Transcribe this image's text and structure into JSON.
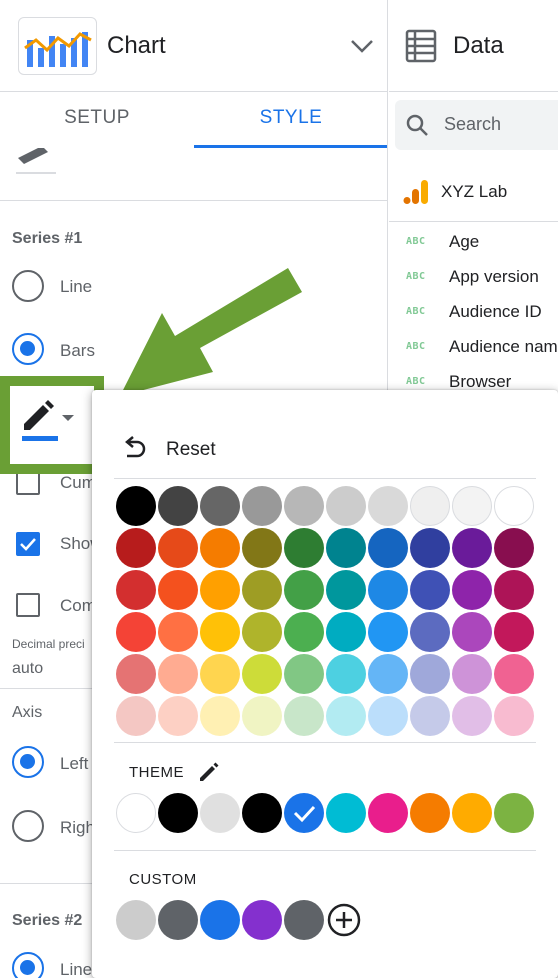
{
  "chart_panel": {
    "title": "Chart",
    "tabs": [
      {
        "label": "SETUP",
        "active": false
      },
      {
        "label": "STYLE",
        "active": true
      }
    ]
  },
  "style": {
    "series1": {
      "heading": "Series #1",
      "type_options": [
        {
          "label": "Line",
          "checked": false
        },
        {
          "label": "Bars",
          "checked": true
        }
      ],
      "checkboxes": [
        {
          "label": "Cum",
          "checked": false
        },
        {
          "label": "Show",
          "checked": true
        },
        {
          "label": "Com",
          "checked": false
        }
      ],
      "decimal_precision_label": "Decimal preci",
      "decimal_precision_value": "auto",
      "axis_heading": "Axis",
      "axis_options": [
        {
          "label": "Left",
          "checked": true
        },
        {
          "label": "Righ",
          "checked": false
        }
      ]
    },
    "series2": {
      "heading": "Series #2",
      "type_options": [
        {
          "label": "Line",
          "checked": true
        }
      ]
    },
    "series_color": "#1a73e8"
  },
  "data_panel": {
    "title": "Data",
    "search_placeholder": "Search",
    "source_name": "XYZ Lab",
    "fields": [
      {
        "type": "ABC",
        "name": "Age"
      },
      {
        "type": "ABC",
        "name": "App version"
      },
      {
        "type": "ABC",
        "name": "Audience ID"
      },
      {
        "type": "ABC",
        "name": "Audience name"
      },
      {
        "type": "ABC",
        "name": "Browser"
      }
    ]
  },
  "color_picker": {
    "reset_label": "Reset",
    "palette": [
      [
        "#000000",
        "#434343",
        "#666666",
        "#999999",
        "#b7b7b7",
        "#cccccc",
        "#d9d9d9",
        "#efefef",
        "#f3f3f3",
        "#ffffff"
      ],
      [
        "#b71c1c",
        "#e64a19",
        "#f57c00",
        "#827717",
        "#2e7d32",
        "#00838f",
        "#1565c0",
        "#303f9f",
        "#6a1b9a",
        "#880e4f"
      ],
      [
        "#d32f2f",
        "#f4511e",
        "#ffa000",
        "#9e9d24",
        "#43a047",
        "#00979d",
        "#1e88e5",
        "#3f51b5",
        "#8e24aa",
        "#ad1457"
      ],
      [
        "#f44336",
        "#ff7043",
        "#ffc107",
        "#afb42b",
        "#4caf50",
        "#00acc1",
        "#2196f3",
        "#5c6bc0",
        "#ab47bc",
        "#c2185b"
      ],
      [
        "#e57373",
        "#ffab91",
        "#ffd54f",
        "#cddc39",
        "#81c784",
        "#4dd0e1",
        "#64b5f6",
        "#9fa8da",
        "#ce93d8",
        "#f06292"
      ],
      [
        "#f4c7c3",
        "#fdd0c4",
        "#fff0b3",
        "#f0f4c3",
        "#c8e6c9",
        "#b2ebf2",
        "#bbdefb",
        "#c5cae9",
        "#e1bee7",
        "#f8bbd0"
      ]
    ],
    "theme_label": "THEME",
    "theme_colors": [
      "#ffffff",
      "#000000",
      "#e0e0e0",
      "#000000",
      "#1a73e8",
      "#00bcd4",
      "#e91e8c",
      "#f57c00",
      "#ffab00",
      "#7cb342"
    ],
    "theme_selected_index": 4,
    "custom_label": "CUSTOM",
    "custom_colors": [
      "#cccccc",
      "#5f6368",
      "#1a73e8",
      "#8430ce",
      "#5f6368"
    ]
  }
}
